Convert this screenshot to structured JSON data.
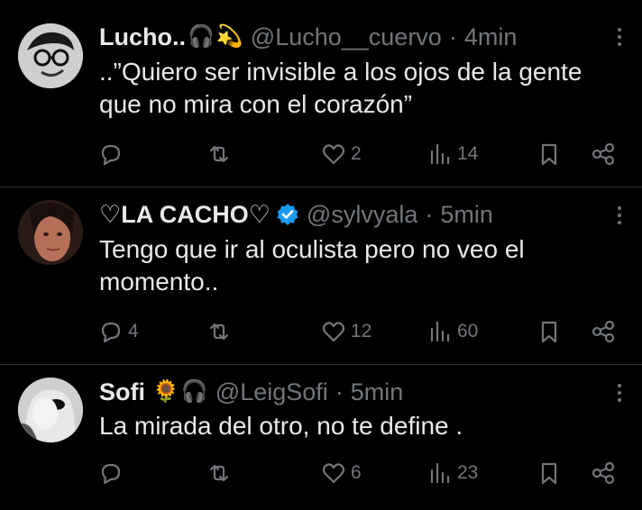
{
  "tweets": [
    {
      "name": "Lucho..",
      "handle": "@Lucho__cuervo",
      "dot": "·",
      "time": "4min",
      "name_emojis": [
        "🎧",
        "💫"
      ],
      "text_lines": [
        "..”Quiero ser invisible a los ojos de la gente",
        "que no mira con el corazón”"
      ],
      "replies": "",
      "reposts": "",
      "likes": "2",
      "views": "14",
      "verified": false
    },
    {
      "name": "♡LA CACHO♡",
      "handle": "@sylvyala",
      "dot": "·",
      "time": "5min",
      "name_emojis": [],
      "text_lines": [
        "Tengo que ir al oculista pero no veo el",
        "momento.."
      ],
      "replies": "4",
      "reposts": "",
      "likes": "12",
      "views": "60",
      "verified": true
    },
    {
      "name": "Sofi",
      "handle": "@LeigSofi",
      "dot": "·",
      "time": "5min",
      "name_emojis": [
        "🌻",
        "🎧"
      ],
      "text_lines": [
        "La mirada del otro, no te define ."
      ],
      "replies": "",
      "reposts": "",
      "likes": "6",
      "views": "23",
      "verified": false
    }
  ],
  "colors": {
    "background": "#000000",
    "text": "#e7e9ea",
    "muted": "#71767b",
    "divider": "#2f3336",
    "verified": "#1d9bf0"
  },
  "icons": [
    "reply-icon",
    "repost-icon",
    "like-icon",
    "views-icon",
    "bookmark-icon",
    "share-icon",
    "more-icon",
    "verified-badge-icon"
  ]
}
